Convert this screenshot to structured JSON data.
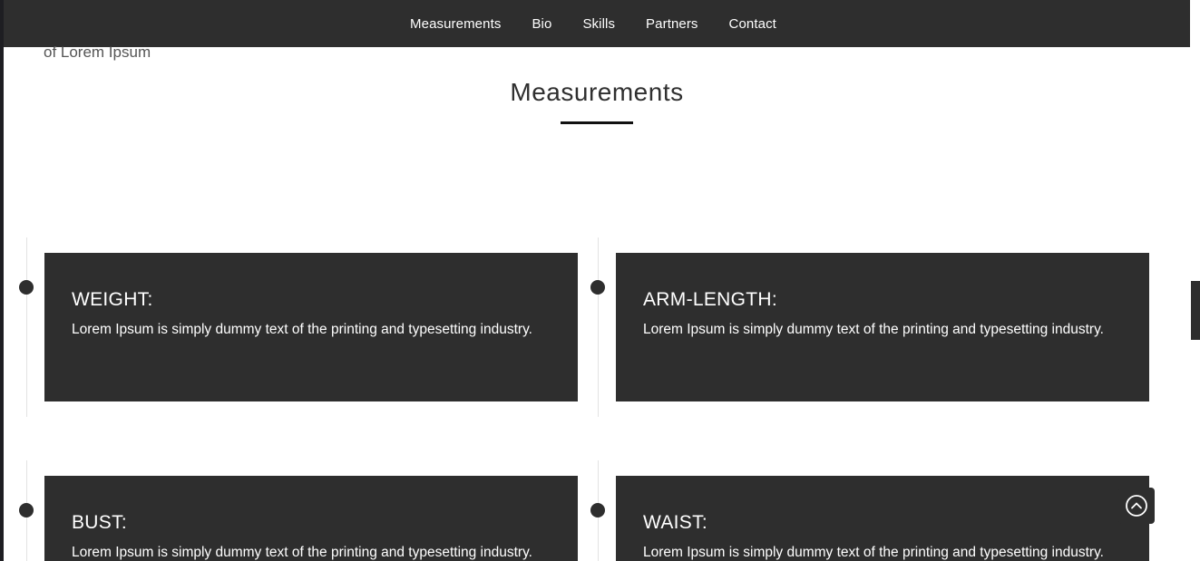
{
  "nav": {
    "items": [
      {
        "label": "Measurements"
      },
      {
        "label": "Bio"
      },
      {
        "label": "Skills"
      },
      {
        "label": "Partners"
      },
      {
        "label": "Contact"
      }
    ]
  },
  "hero": {
    "fragment_text": "of Lorem Ipsum"
  },
  "measurements": {
    "title": "Measurements",
    "cards": [
      {
        "title": "WEIGHT:",
        "text": "Lorem Ipsum is simply dummy text of the printing and typesetting industry."
      },
      {
        "title": "ARM-LENGTH:",
        "text": "Lorem Ipsum is simply dummy text of the printing and typesetting industry."
      },
      {
        "title": "BUST:",
        "text": "Lorem Ipsum is simply dummy text of the printing and typesetting industry."
      },
      {
        "title": "WAIST:",
        "text": "Lorem Ipsum is simply dummy text of the printing and typesetting industry."
      }
    ]
  },
  "icons": {
    "scroll_top": "chevron-up-circle-icon",
    "timeline_marker": "dot-icon"
  },
  "colors": {
    "dark": "#2e2e2e",
    "background": "#ffffff",
    "text_light": "#ffffff"
  }
}
